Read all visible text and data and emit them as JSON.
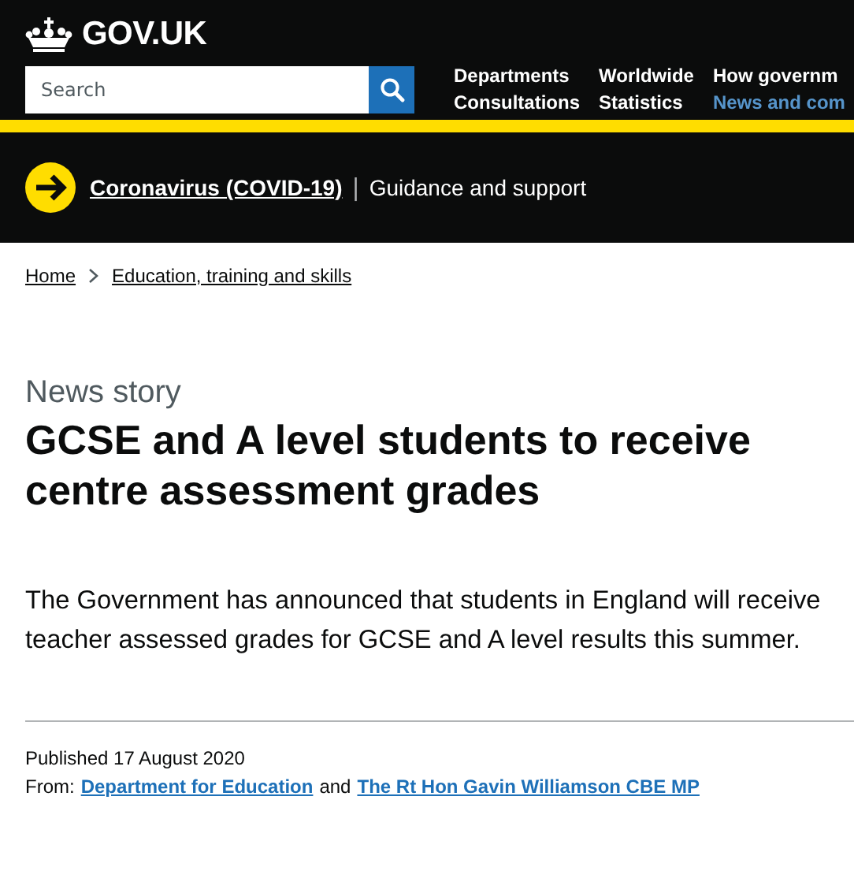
{
  "header": {
    "logo": "GOV.UK",
    "search": {
      "placeholder": "Search"
    },
    "nav": [
      {
        "label": "Departments",
        "selected": false
      },
      {
        "label": "Worldwide",
        "selected": false
      },
      {
        "label": "How governm",
        "selected": false
      },
      {
        "label": "Consultations",
        "selected": false
      },
      {
        "label": "Statistics",
        "selected": false
      },
      {
        "label": "News and com",
        "selected": true
      }
    ]
  },
  "banner": {
    "link": "Coronavirus (COVID-19)",
    "separator": "|",
    "text": "Guidance and support"
  },
  "breadcrumbs": [
    "Home",
    "Education, training and skills"
  ],
  "article": {
    "type": "News story",
    "title": "GCSE and A level students to receive centre assessment grades",
    "lead": "The Government has announced that students in England will receive teacher assessed grades for GCSE and A level results this summer.",
    "published": "Published 17 August 2020",
    "from_label": "From:",
    "from": [
      "Department for Education",
      "The Rt Hon Gavin Williamson CBE MP"
    ],
    "joiner": "and"
  }
}
